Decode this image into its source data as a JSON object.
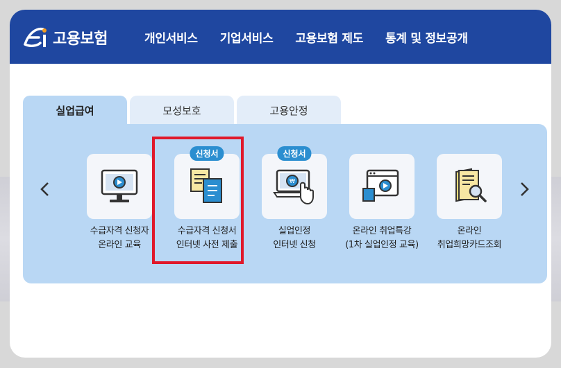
{
  "header": {
    "logo_text": "고용보험",
    "nav": [
      "개인서비스",
      "기업서비스",
      "고용보험 제도",
      "통계 및 정보공개"
    ]
  },
  "tabs": [
    {
      "label": "실업급여",
      "active": true
    },
    {
      "label": "모성보호",
      "active": false
    },
    {
      "label": "고용안정",
      "active": false
    }
  ],
  "items": [
    {
      "line1": "수급자격 신청자",
      "line2": "온라인 교육",
      "badge": "",
      "icon": "monitor-play-icon"
    },
    {
      "line1": "수급자격 신청서",
      "line2": "인터넷 사전 제출",
      "badge": "신청서",
      "icon": "documents-icon"
    },
    {
      "line1": "실업인정",
      "line2": "인터넷 신청",
      "badge": "신청서",
      "icon": "laptop-click-icon"
    },
    {
      "line1": "온라인 취업특강",
      "line2": "(1차 실업인정 교육)",
      "badge": "",
      "icon": "video-window-icon"
    },
    {
      "line1": "온라인",
      "line2": "취업희망카드조회",
      "badge": "",
      "icon": "card-search-icon"
    }
  ],
  "highlighted_item": 1,
  "colors": {
    "header": "#1f47a0",
    "panel": "#b9d7f4",
    "badge": "#2b8ed0",
    "highlight": "#e0182a"
  }
}
